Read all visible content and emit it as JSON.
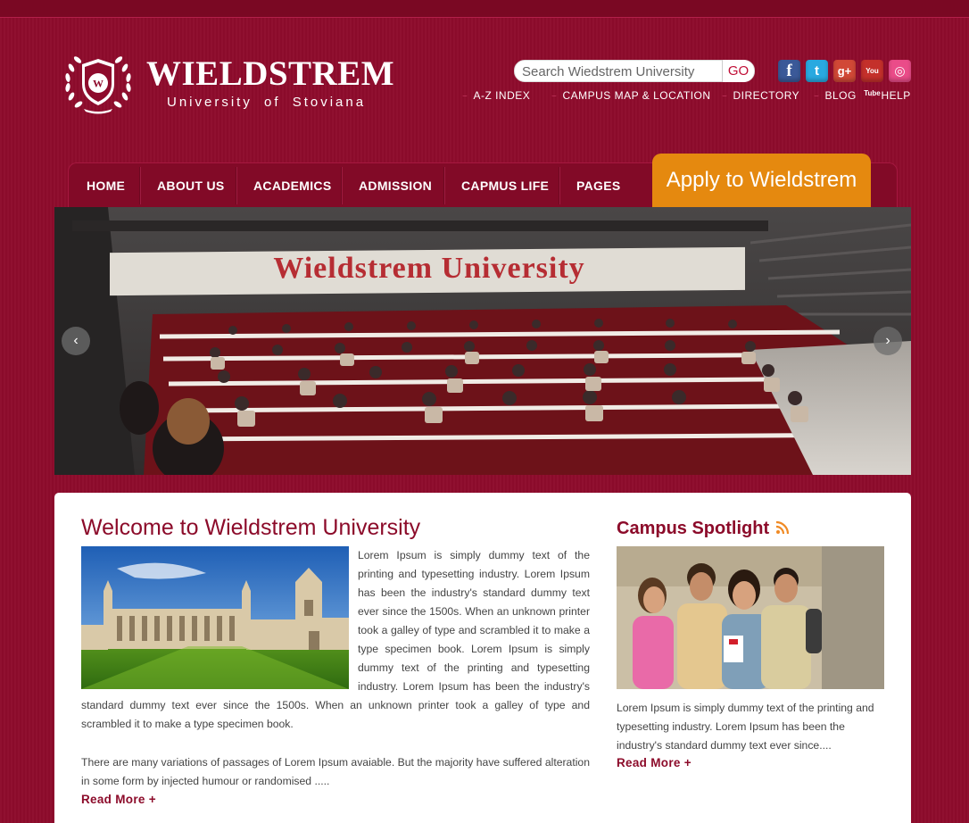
{
  "brand": {
    "title": "WIELDSTREM",
    "subtitle": "University of  Stoviana",
    "badge_letter": "W"
  },
  "search": {
    "placeholder": "Search Wiedstrem University",
    "go_label": "GO"
  },
  "social": [
    {
      "name": "facebook",
      "glyph": "f",
      "color": "#3b5998"
    },
    {
      "name": "twitter",
      "glyph": "t",
      "color": "#29a9e0"
    },
    {
      "name": "google-plus",
      "glyph": "g+",
      "color": "#d14836"
    },
    {
      "name": "youtube",
      "glyph": "You Tube",
      "color": "#c4302b"
    },
    {
      "name": "dribbble",
      "glyph": "◎",
      "color": "#ea4c89"
    }
  ],
  "quick_links": [
    "A-Z INDEX",
    "CAMPUS MAP & LOCATION",
    "DIRECTORY",
    "BLOG",
    "HELP"
  ],
  "nav": {
    "items": [
      "HOME",
      "ABOUT US",
      "ACADEMICS",
      "ADMISSION",
      "CAPMUS LIFE",
      "PAGES"
    ],
    "apply_label": "Apply to Wieldstrem"
  },
  "hero": {
    "banner_text": "Wieldstrem University",
    "prev_arrow": "‹",
    "next_arrow": "›"
  },
  "welcome": {
    "title": "Welcome to Wieldstrem University",
    "para1": "Lorem Ipsum is simply dummy text of the printing and typesetting industry. Lorem Ipsum has been the industry's standard dummy text ever since the 1500s. When an unknown printer took a galley of type and scrambled it to make a type specimen book. Lorem Ipsum is simply dummy text of the printing and typesetting industry. Lorem Ipsum has been the industry's standard dummy text ever since the 1500s. When an unknown printer took a galley of type and scrambled it to make a type specimen book.",
    "para2": "There are many variations of passages of Lorem Ipsum avaiable. But the majority have suffered alteration in some form by injected humour or randomised .....",
    "read_more": "Read More +"
  },
  "spotlight": {
    "title": "Campus Spotlight",
    "text": "Lorem Ipsum is simply dummy text of the printing and typesetting industry. Lorem Ipsum has been the industry's standard dummy text ever since....",
    "read_more": "Read More +"
  },
  "colors": {
    "background": "#8e0b2c",
    "accent": "#8c0b2a",
    "apply": "#e5890f"
  }
}
